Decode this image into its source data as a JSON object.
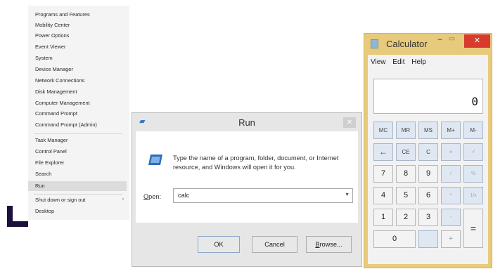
{
  "winx_menu": {
    "items": [
      "Programs and Features",
      "Mobility Center",
      "Power Options",
      "Event Viewer",
      "System",
      "Device Manager",
      "Network Connections",
      "Disk Management",
      "Computer Management",
      "Command Prompt",
      "Command Prompt (Admin)",
      "Task Manager",
      "Control Panel",
      "File Explorer",
      "Search",
      "Run",
      "Shut down or sign out",
      "Desktop"
    ],
    "highlighted": "Run",
    "submenu_arrow": "›"
  },
  "run_dialog": {
    "title": "Run",
    "close_glyph": "✕",
    "description": "Type the name of a program, folder, document, or Internet resource, and Windows will open it for you.",
    "open_label_underlined": "O",
    "open_label_rest": "pen:",
    "open_value": "calc",
    "buttons": {
      "ok": "OK",
      "cancel": "Cancel",
      "browse_underlined": "B",
      "browse_rest": "rowse..."
    }
  },
  "calculator": {
    "title": "Calculator",
    "minimize_glyph": "–",
    "maximize_glyph": "▭",
    "close_glyph": "✕",
    "menu": [
      "View",
      "Edit",
      "Help"
    ],
    "display": "0",
    "keys": {
      "mc": "MC",
      "mr": "MR",
      "ms": "MS",
      "mplus": "M+",
      "mminus": "M-",
      "backspace": "←",
      "ce": "CE",
      "c": "C",
      "plusminus": "±",
      "sqrt": "√",
      "n7": "7",
      "n8": "8",
      "n9": "9",
      "divide": "/",
      "percent": "%",
      "n4": "4",
      "n5": "5",
      "n6": "6",
      "multiply": "*",
      "reciprocal": "1/x",
      "n1": "1",
      "n2": "2",
      "n3": "3",
      "minus": "-",
      "equals": "=",
      "n0": "0",
      "dot": ".",
      "plus": "+"
    }
  }
}
